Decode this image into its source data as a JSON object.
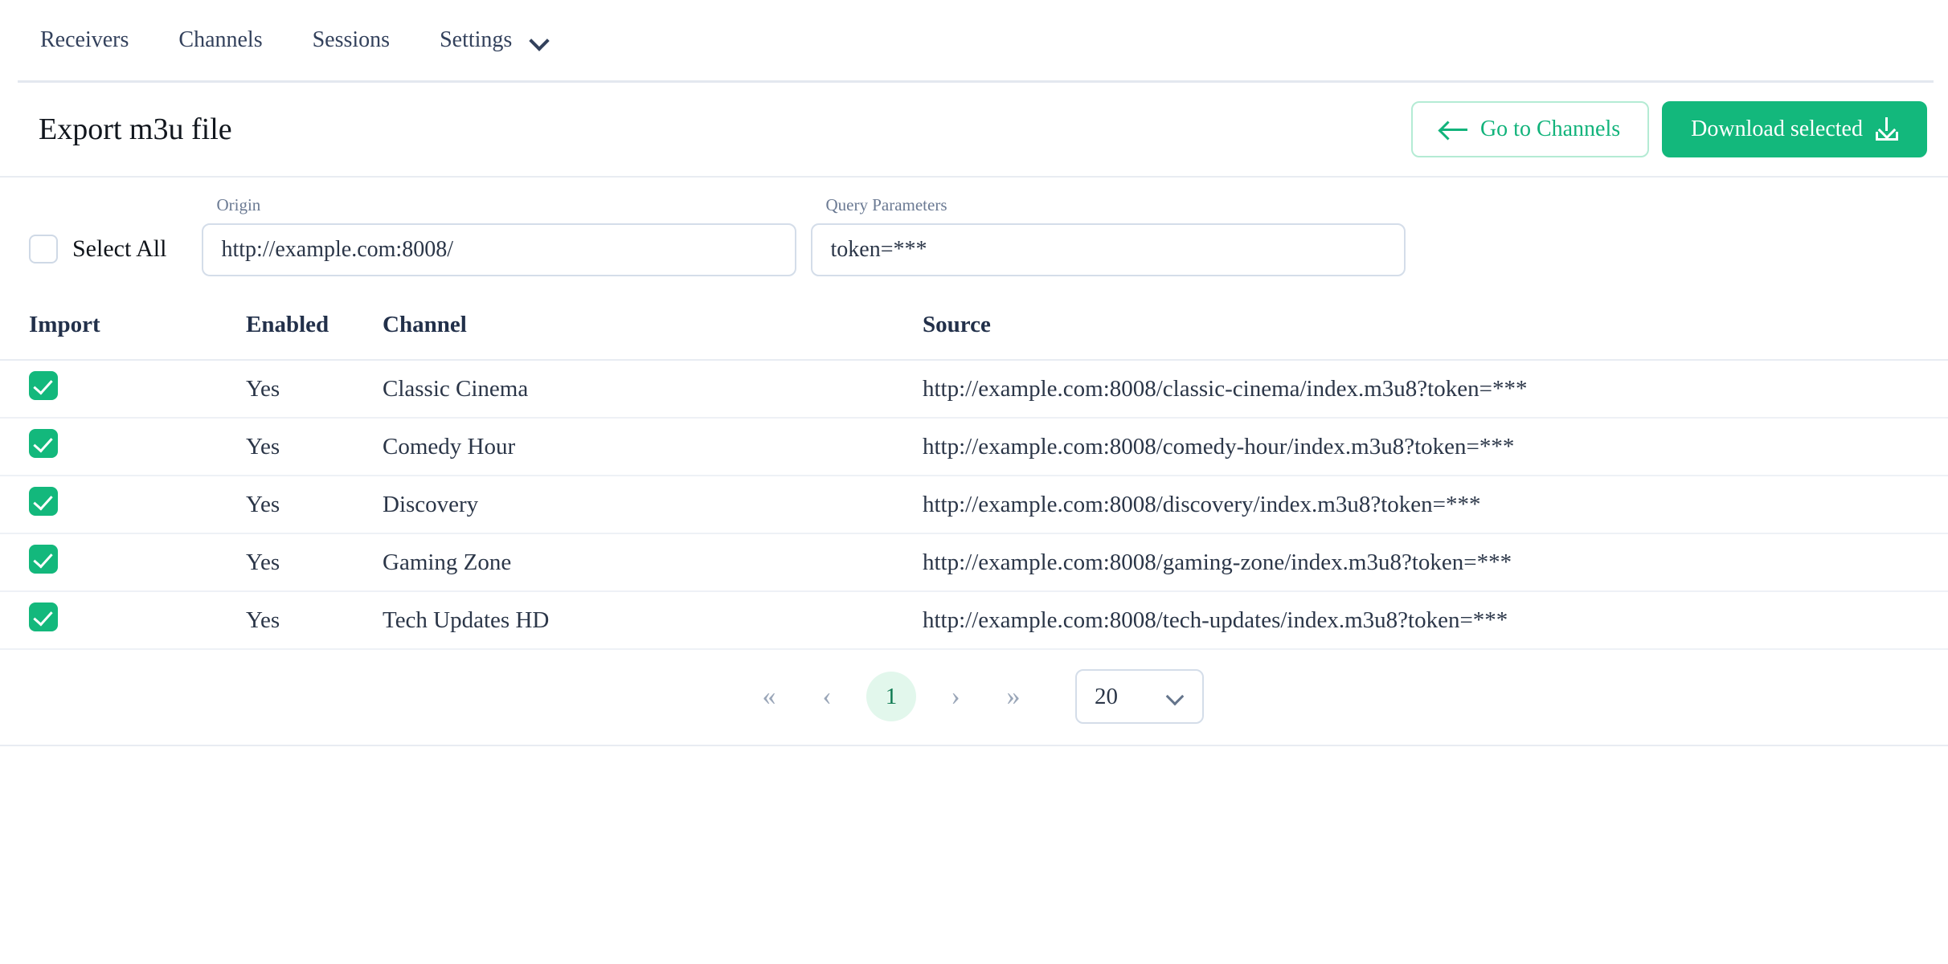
{
  "nav": {
    "items": [
      {
        "label": "Receivers"
      },
      {
        "label": "Channels"
      },
      {
        "label": "Sessions"
      },
      {
        "label": "Settings"
      }
    ],
    "settings_caret_icon": "chevron-down-icon"
  },
  "header": {
    "title": "Export m3u file",
    "back_button": {
      "label": "Go to Channels",
      "icon": "arrow-left-icon"
    },
    "download_button": {
      "label": "Download selected",
      "icon": "download-icon"
    }
  },
  "colors": {
    "accent_green": "#13b87c",
    "accent_green_soft": "#e2f7ec",
    "accent_green_border": "#b4ebd4",
    "text": "#2b3648",
    "muted": "#6b7a93",
    "border": "#d4dde9"
  },
  "filters": {
    "select_all": {
      "label": "Select All",
      "checked": false
    },
    "origin": {
      "label": "Origin",
      "value": "http://example.com:8008/",
      "placeholder": "http://example.com:8008/"
    },
    "query_parameters": {
      "label": "Query Parameters",
      "value": "token=***",
      "placeholder": "token=***"
    }
  },
  "table": {
    "columns": [
      "Import",
      "Enabled",
      "Channel",
      "Source"
    ],
    "rows": [
      {
        "import": true,
        "enabled": "Yes",
        "channel": "Classic Cinema",
        "source": "http://example.com:8008/classic-cinema/index.m3u8?token=***"
      },
      {
        "import": true,
        "enabled": "Yes",
        "channel": "Comedy Hour",
        "source": "http://example.com:8008/comedy-hour/index.m3u8?token=***"
      },
      {
        "import": true,
        "enabled": "Yes",
        "channel": "Discovery",
        "source": "http://example.com:8008/discovery/index.m3u8?token=***"
      },
      {
        "import": true,
        "enabled": "Yes",
        "channel": "Gaming Zone",
        "source": "http://example.com:8008/gaming-zone/index.m3u8?token=***"
      },
      {
        "import": true,
        "enabled": "Yes",
        "channel": "Tech Updates HD",
        "source": "http://example.com:8008/tech-updates/index.m3u8?token=***"
      }
    ]
  },
  "pagination": {
    "first_label": "«",
    "prev_label": "‹",
    "current_page": "1",
    "next_label": "›",
    "last_label": "»",
    "page_size": "20",
    "page_size_caret_icon": "chevron-down-icon"
  }
}
